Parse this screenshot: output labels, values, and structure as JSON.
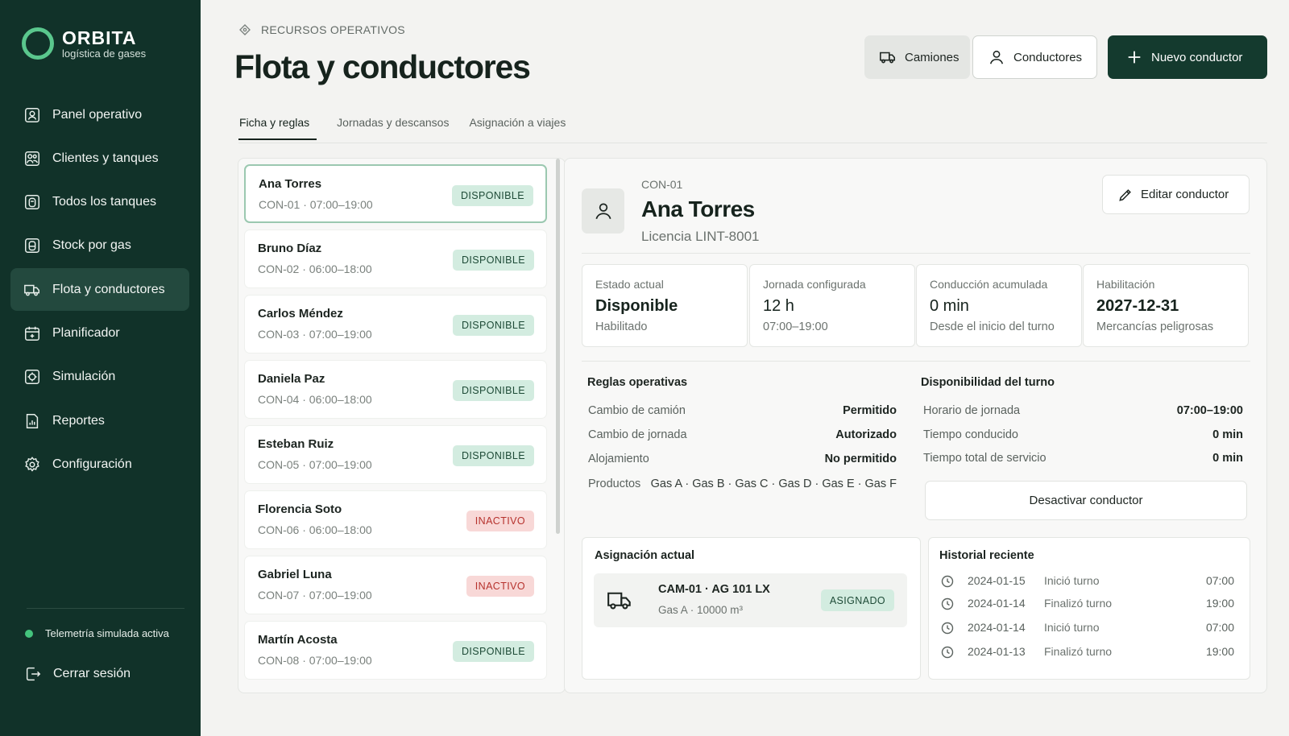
{
  "brand": {
    "name": "ORBITA",
    "tagline": "logística de gases"
  },
  "sidebar": {
    "items": [
      {
        "label": "Panel operativo",
        "icon": "dashboard-icon"
      },
      {
        "label": "Clientes y tanques",
        "icon": "clients-icon"
      },
      {
        "label": "Todos los tanques",
        "icon": "tanks-icon"
      },
      {
        "label": "Stock por gas",
        "icon": "stock-icon"
      },
      {
        "label": "Flota y conductores",
        "icon": "truck-icon",
        "active": true
      },
      {
        "label": "Planificador",
        "icon": "calendar-icon"
      },
      {
        "label": "Simulación",
        "icon": "simulation-icon"
      },
      {
        "label": "Reportes",
        "icon": "report-icon"
      },
      {
        "label": "Configuración",
        "icon": "gear-icon"
      }
    ],
    "telemetry": "Telemetría simulada activa",
    "logout": "Cerrar sesión"
  },
  "header": {
    "eyebrow": "RECURSOS OPERATIVOS",
    "title": "Flota y conductores",
    "btn_trucks": "Camiones",
    "btn_drivers": "Conductores",
    "btn_new": "Nuevo conductor"
  },
  "tabs": [
    {
      "label": "Ficha y reglas",
      "active": true
    },
    {
      "label": "Jornadas y descansos"
    },
    {
      "label": "Asignación a viajes"
    }
  ],
  "drivers": [
    {
      "name": "Ana Torres",
      "meta": "CON-01 · 07:00–19:00",
      "status": "DISPONIBLE"
    },
    {
      "name": "Bruno Díaz",
      "meta": "CON-02 · 06:00–18:00",
      "status": "DISPONIBLE"
    },
    {
      "name": "Carlos Méndez",
      "meta": "CON-03 · 07:00–19:00",
      "status": "DISPONIBLE"
    },
    {
      "name": "Daniela Paz",
      "meta": "CON-04 · 06:00–18:00",
      "status": "DISPONIBLE"
    },
    {
      "name": "Esteban Ruiz",
      "meta": "CON-05 · 07:00–19:00",
      "status": "DISPONIBLE"
    },
    {
      "name": "Florencia Soto",
      "meta": "CON-06 · 06:00–18:00",
      "status": "INACTIVO"
    },
    {
      "name": "Gabriel Luna",
      "meta": "CON-07 · 07:00–19:00",
      "status": "INACTIVO"
    },
    {
      "name": "Martín Acosta",
      "meta": "CON-08 · 07:00–19:00",
      "status": "DISPONIBLE"
    }
  ],
  "detail": {
    "code": "CON-01",
    "name": "Ana Torres",
    "license": "Licencia LINT-8001",
    "edit_label": "Editar conductor",
    "stats": [
      {
        "label": "Estado actual",
        "value": "Disponible",
        "sub": "Habilitado"
      },
      {
        "label": "Jornada configurada",
        "value": "12 h",
        "sub": "07:00–19:00"
      },
      {
        "label": "Conducción acumulada",
        "value": "0 min",
        "sub": "Desde el inicio del turno"
      },
      {
        "label": "Habilitación",
        "value": "2027-12-31",
        "sub": "Mercancías peligrosas"
      }
    ],
    "rules_title": "Reglas operativas",
    "rules": [
      {
        "label": "Cambio de camión",
        "value": "Permitido"
      },
      {
        "label": "Cambio de jornada",
        "value": "Autorizado"
      },
      {
        "label": "Alojamiento",
        "value": "No permitido"
      },
      {
        "label": "Productos",
        "value": "Gas A · Gas B · Gas C · Gas D · Gas E · Gas F"
      }
    ],
    "availability_title": "Disponibilidad del turno",
    "availability": [
      {
        "label": "Horario de jornada",
        "value": "07:00–19:00"
      },
      {
        "label": "Tiempo conducido",
        "value": "0 min"
      },
      {
        "label": "Tiempo total de servicio",
        "value": "0 min"
      }
    ],
    "deactivate_label": "Desactivar conductor",
    "assignment": {
      "title": "Asignación actual",
      "truck": "CAM-01 · AG 101 LX",
      "sub": "Gas A · 10000 m³",
      "status": "ASIGNADO"
    },
    "history": {
      "title": "Historial reciente",
      "rows": [
        {
          "date": "2024-01-15",
          "event": "Inició turno",
          "time": "07:00"
        },
        {
          "date": "2024-01-14",
          "event": "Finalizó turno",
          "time": "19:00"
        },
        {
          "date": "2024-01-14",
          "event": "Inició turno",
          "time": "07:00"
        },
        {
          "date": "2024-01-13",
          "event": "Finalizó turno",
          "time": "19:00"
        }
      ]
    }
  },
  "colors": {
    "sidebar_bg": "#113229",
    "accent": "#143a2e",
    "ok_badge": "#d3ece0",
    "off_badge": "#f8d8d7",
    "logo": "#5ac78d"
  }
}
